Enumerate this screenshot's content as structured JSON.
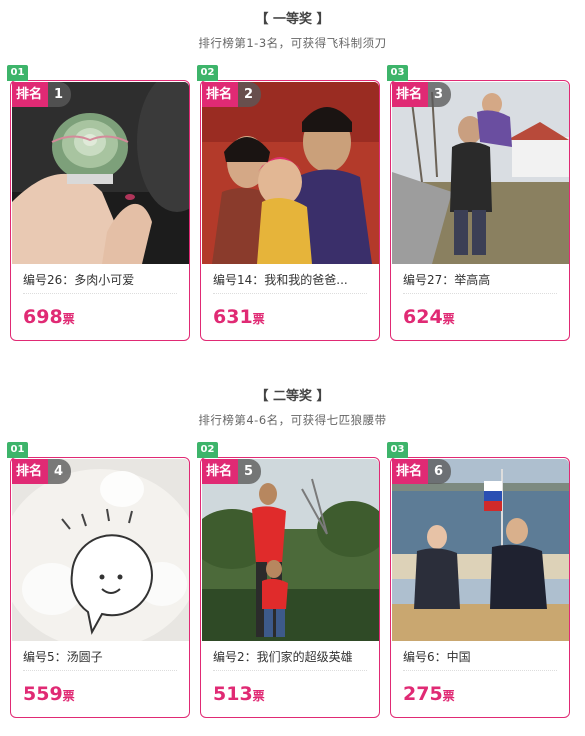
{
  "colors": {
    "accent": "#e02a74",
    "index_badge": "#3db46a"
  },
  "sections": [
    {
      "title": "【 一等奖 】",
      "subtitle": "排行榜第1-3名，可获得飞科制须刀",
      "cards": [
        {
          "index": "01",
          "rank_label": "排名",
          "rank": "1",
          "name": "编号26：多肉小可爱",
          "votes": "698",
          "unit": "票"
        },
        {
          "index": "02",
          "rank_label": "排名",
          "rank": "2",
          "name": "编号14：我和我的爸爸...",
          "votes": "631",
          "unit": "票"
        },
        {
          "index": "03",
          "rank_label": "排名",
          "rank": "3",
          "name": "编号27：举高高",
          "votes": "624",
          "unit": "票"
        }
      ]
    },
    {
      "title": "【 二等奖 】",
      "subtitle": "排行榜第4-6名，可获得七匹狼腰带",
      "cards": [
        {
          "index": "01",
          "rank_label": "排名",
          "rank": "4",
          "name": "编号5：汤圆子",
          "votes": "559",
          "unit": "票"
        },
        {
          "index": "02",
          "rank_label": "排名",
          "rank": "5",
          "name": "编号2：我们家的超级英雄",
          "votes": "513",
          "unit": "票"
        },
        {
          "index": "03",
          "rank_label": "排名",
          "rank": "6",
          "name": "编号6：中国",
          "votes": "275",
          "unit": "票"
        }
      ]
    }
  ]
}
